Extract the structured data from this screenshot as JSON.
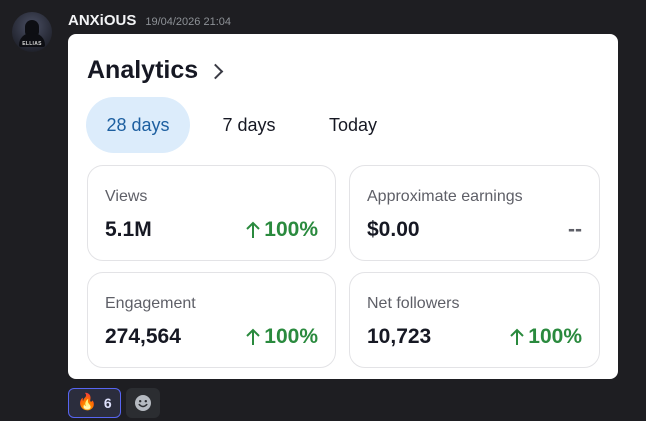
{
  "author": {
    "username": "ANXiOUS",
    "timestamp": "19/04/2026 21:04",
    "avatar_tag": "ELLIAS"
  },
  "card": {
    "title": "Analytics",
    "tabs": [
      {
        "label": "28 days",
        "active": true
      },
      {
        "label": "7 days",
        "active": false
      },
      {
        "label": "Today",
        "active": false
      }
    ],
    "metrics": [
      {
        "label": "Views",
        "value": "5.1M",
        "change": "100%",
        "trend": "up"
      },
      {
        "label": "Approximate earnings",
        "value": "$0.00",
        "change": "--",
        "trend": "none"
      },
      {
        "label": "Engagement",
        "value": "274,564",
        "change": "100%",
        "trend": "up"
      },
      {
        "label": "Net followers",
        "value": "10,723",
        "change": "100%",
        "trend": "up"
      }
    ]
  },
  "reactions": [
    {
      "emoji": "🔥",
      "icon": "fire-emoji",
      "count": "6"
    }
  ],
  "colors": {
    "positive": "#2a8a3e",
    "active_tab_bg": "#dcecfb",
    "active_tab_text": "#1d5fa0",
    "reaction_border": "#5865f2"
  }
}
